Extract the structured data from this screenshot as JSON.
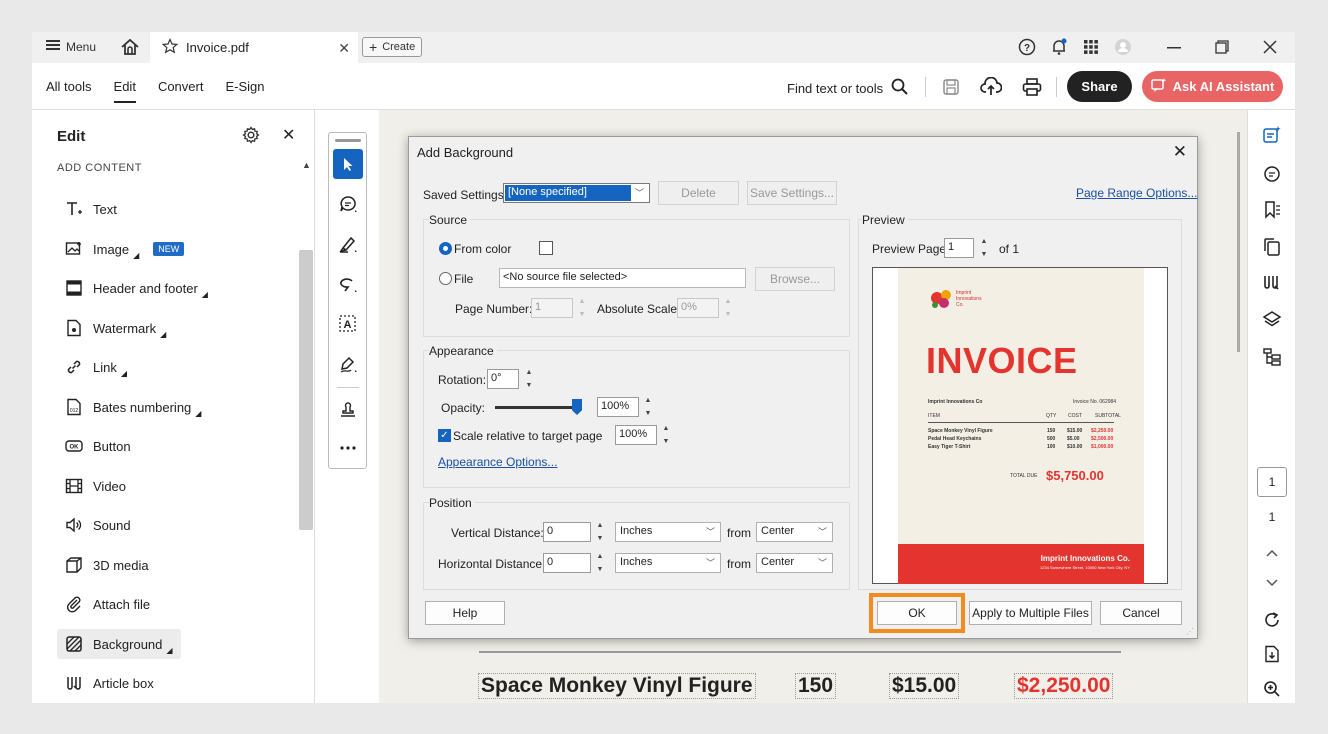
{
  "tabbar": {
    "menu_label": "Menu",
    "tab_title": "Invoice.pdf",
    "create_label": "Create"
  },
  "toolbar": {
    "tabs": [
      "All tools",
      "Edit",
      "Convert",
      "E-Sign"
    ],
    "find_label": "Find text or tools",
    "share_label": "Share",
    "ai_label": "Ask AI Assistant"
  },
  "leftpanel": {
    "title": "Edit",
    "section": "ADD CONTENT",
    "items": [
      {
        "label": "Text",
        "icon": "text-icon"
      },
      {
        "label": "Image",
        "icon": "image-icon",
        "badge": "NEW"
      },
      {
        "label": "Header and footer",
        "icon": "header-footer-icon"
      },
      {
        "label": "Watermark",
        "icon": "watermark-icon"
      },
      {
        "label": "Link",
        "icon": "link-icon"
      },
      {
        "label": "Bates numbering",
        "icon": "bates-icon"
      },
      {
        "label": "Button",
        "icon": "button-icon"
      },
      {
        "label": "Video",
        "icon": "video-icon"
      },
      {
        "label": "Sound",
        "icon": "sound-icon"
      },
      {
        "label": "3D media",
        "icon": "3d-icon"
      },
      {
        "label": "Attach file",
        "icon": "attach-icon"
      },
      {
        "label": "Background",
        "icon": "background-icon"
      },
      {
        "label": "Article box",
        "icon": "article-box-icon"
      }
    ]
  },
  "dialog": {
    "title": "Add Background",
    "saved_settings_label": "Saved Settings:",
    "saved_settings_value": "[None specified]",
    "delete_label": "Delete",
    "save_settings_label": "Save Settings...",
    "page_range_link": "Page Range Options...",
    "source": {
      "legend": "Source",
      "from_color_label": "From color",
      "file_label": "File",
      "file_value": "<No source file selected>",
      "browse_label": "Browse...",
      "page_number_label": "Page Number:",
      "page_number_value": "1",
      "absolute_scale_label": "Absolute Scale:",
      "absolute_scale_value": "0%"
    },
    "appearance": {
      "legend": "Appearance",
      "rotation_label": "Rotation:",
      "rotation_value": "0°",
      "opacity_label": "Opacity:",
      "opacity_value": "100%",
      "opacity_level": 1.0,
      "scale_label": "Scale relative to target page",
      "scale_value": "100%",
      "options_link": "Appearance Options..."
    },
    "position": {
      "legend": "Position",
      "vertical_label": "Vertical Distance:",
      "vertical_value": "0",
      "horizontal_label": "Horizontal Distance:",
      "horizontal_value": "0",
      "unit_value": "Inches",
      "from_label": "from",
      "from_value": "Center"
    },
    "preview": {
      "legend": "Preview",
      "page_label": "Preview Page",
      "page_value": "1",
      "of_label": "of 1"
    },
    "help_label": "Help",
    "ok_label": "OK",
    "apply_multiple_label": "Apply to Multiple Files",
    "cancel_label": "Cancel"
  },
  "preview_invoice": {
    "logo_text": "Imprint\nInnovations\nCo.",
    "heading": "INVOICE",
    "company": "Imprint Innovations Co",
    "invoice_no": "Invoice No. 062984",
    "headers": [
      "ITEM",
      "QTY",
      "COST",
      "SUBTOTAL"
    ],
    "rows": [
      [
        "Space Monkey Vinyl Figure",
        "150",
        "$15.00",
        "$2,250.00"
      ],
      [
        "Pedal Head Keychains",
        "500",
        "$5.00",
        "$2,500.00"
      ],
      [
        "Easy Tiger T-Shirt",
        "100",
        "$10.00",
        "$1,000.00"
      ]
    ],
    "total_label": "TOTAL DUE",
    "total_value": "$5,750.00",
    "footer_name": "Imprint Innovations Co.",
    "footer_address": "1234 Somewhere Street, 10000 New York City, NY"
  },
  "document": {
    "row": [
      "Space Monkey Vinyl Figure",
      "150",
      "$15.00",
      "$2,250.00"
    ]
  },
  "rail": {
    "page_current": "1",
    "page_total": "1"
  },
  "colors": {
    "accent": "#1565c0",
    "invoice_red": "#e3342f",
    "ai_button": "#e96464",
    "highlight": "#f28c1e"
  }
}
